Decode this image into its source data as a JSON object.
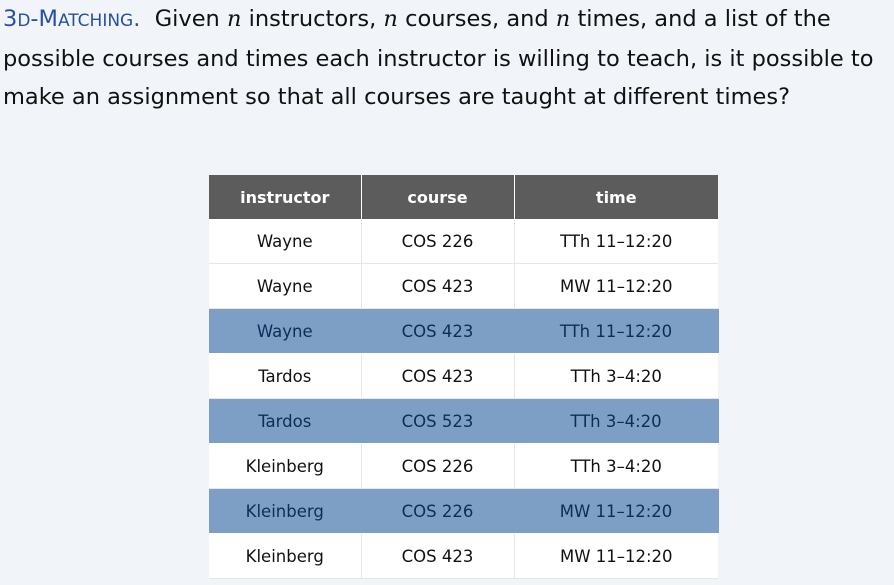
{
  "problem": {
    "term_first": "3",
    "term_d": "D",
    "term_dash": "-",
    "term_m": "M",
    "term_rest": "ATCHING",
    "term_period": ".",
    "text_1": "  Given ",
    "var_1": "n",
    "text_2": " instructors, ",
    "var_2": "n",
    "text_3": " courses, and ",
    "var_3": "n",
    "text_4": " times, and a list of the possible courses and times each instructor is willing to teach, is it possible to make an assignment so that all courses are taught at different times?"
  },
  "table": {
    "headers": [
      "instructor",
      "course",
      "time"
    ],
    "rows": [
      {
        "instructor": "Wayne",
        "course": "COS 226",
        "time": "TTh 11–12:20",
        "highlighted": false
      },
      {
        "instructor": "Wayne",
        "course": "COS 423",
        "time": "MW 11–12:20",
        "highlighted": false
      },
      {
        "instructor": "Wayne",
        "course": "COS 423",
        "time": "TTh 11–12:20",
        "highlighted": true
      },
      {
        "instructor": "Tardos",
        "course": "COS 423",
        "time": "TTh 3–4:20",
        "highlighted": false
      },
      {
        "instructor": "Tardos",
        "course": "COS 523",
        "time": "TTh 3–4:20",
        "highlighted": true
      },
      {
        "instructor": "Kleinberg",
        "course": "COS 226",
        "time": "TTh 3–4:20",
        "highlighted": false
      },
      {
        "instructor": "Kleinberg",
        "course": "COS 226",
        "time": "MW 11–12:20",
        "highlighted": true
      },
      {
        "instructor": "Kleinberg",
        "course": "COS 423",
        "time": "MW 11–12:20",
        "highlighted": false
      }
    ]
  },
  "colors": {
    "term": "#2a4fa2",
    "header_bg": "#5c5c5c",
    "highlight_bg": "#7d9fc5",
    "page_bg": "#f1f5f9"
  }
}
